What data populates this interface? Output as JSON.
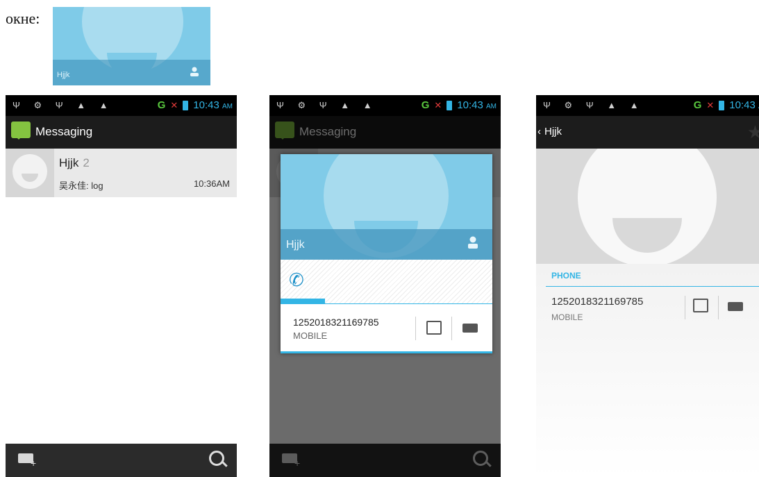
{
  "caption": {
    "text": "окне:"
  },
  "crop": {
    "name": "Hjjk"
  },
  "status": {
    "time": "10:43",
    "ampm": "AM",
    "signal": "G",
    "icons": "Ψ ⚙ Ψ ▲ ▲"
  },
  "app": {
    "title": "Messaging"
  },
  "conversation": {
    "name": "Hjjk",
    "count": "2",
    "snippet": "吴永佳: log",
    "time": "10:36AM"
  },
  "quick_contact": {
    "name": "Hjjk",
    "number": "1252018321169785",
    "type": "MOBILE"
  },
  "detail": {
    "name": "Hjjk",
    "section": "PHONE",
    "number": "1252018321169785",
    "type": "MOBILE"
  },
  "colors": {
    "accent": "#33b5e5",
    "messaging_icon": "#84c340",
    "signal": "#59c83e"
  }
}
